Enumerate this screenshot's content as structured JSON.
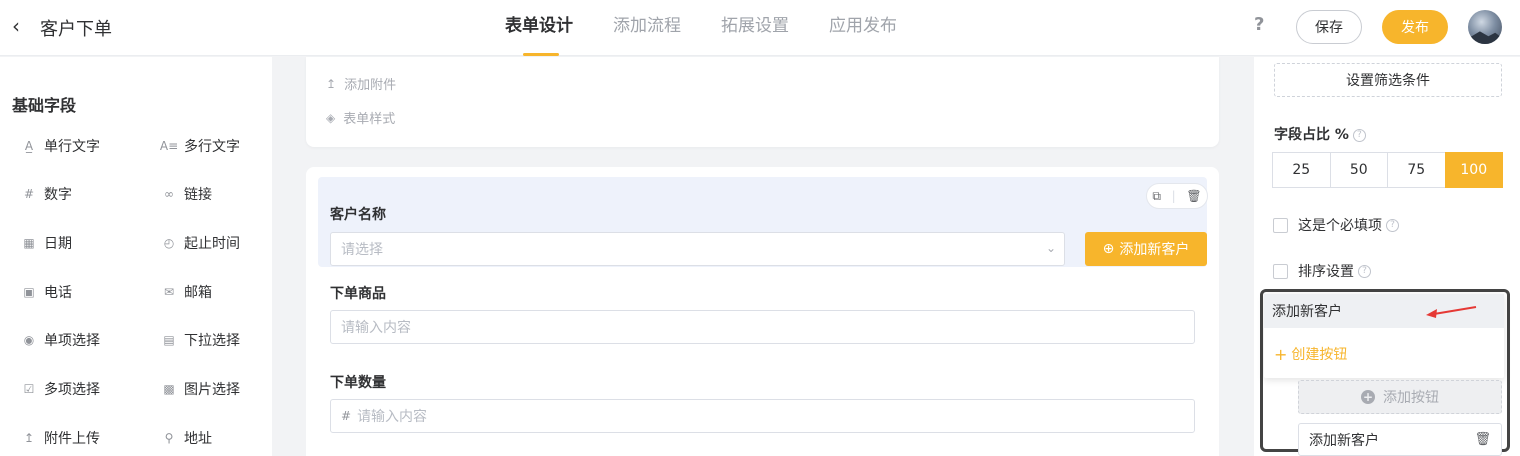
{
  "header": {
    "back_icon": "chevron-left",
    "title": "客户下单",
    "tabs": [
      {
        "label": "表单设计",
        "active": true
      },
      {
        "label": "添加流程",
        "active": false
      },
      {
        "label": "拓展设置",
        "active": false
      },
      {
        "label": "应用发布",
        "active": false
      }
    ],
    "help": "?",
    "save_label": "保存",
    "publish_label": "发布",
    "accent_color": "#f7b52c"
  },
  "left_panel": {
    "title": "基础字段",
    "fields": [
      {
        "label": "单行文字",
        "icon": "text-icon"
      },
      {
        "label": "多行文字",
        "icon": "multiline-icon"
      },
      {
        "label": "数字",
        "icon": "number-icon"
      },
      {
        "label": "链接",
        "icon": "link-icon"
      },
      {
        "label": "日期",
        "icon": "calendar-icon"
      },
      {
        "label": "起止时间",
        "icon": "time-range-icon"
      },
      {
        "label": "电话",
        "icon": "phone-icon"
      },
      {
        "label": "邮箱",
        "icon": "mail-icon"
      },
      {
        "label": "单项选择",
        "icon": "radio-icon"
      },
      {
        "label": "下拉选择",
        "icon": "dropdown-icon"
      },
      {
        "label": "多项选择",
        "icon": "checkbox-icon"
      },
      {
        "label": "图片选择",
        "icon": "image-icon"
      },
      {
        "label": "附件上传",
        "icon": "upload-icon"
      },
      {
        "label": "地址",
        "icon": "location-icon"
      }
    ]
  },
  "canvas": {
    "top_items": [
      {
        "label": "添加附件",
        "icon": "upload-icon"
      },
      {
        "label": "表单样式",
        "icon": "palette-icon"
      }
    ],
    "customer": {
      "label": "客户名称",
      "placeholder": "请选择",
      "add_button": "添加新客户"
    },
    "product": {
      "label": "下单商品",
      "placeholder": "请输入内容"
    },
    "quantity": {
      "label": "下单数量",
      "placeholder": "请输入内容"
    }
  },
  "right_panel": {
    "filter_button": "设置筛选条件",
    "ratio_label": "字段占比 %",
    "ratio_options": [
      "25",
      "50",
      "75",
      "100"
    ],
    "ratio_selected": "100",
    "required_label": "这是个必填项",
    "sort_label": "排序设置",
    "dropdown": {
      "selected_item": "添加新客户",
      "create_label": "创建按钮"
    },
    "add_button_label": "添加按钮",
    "button_item": "添加新客户"
  }
}
